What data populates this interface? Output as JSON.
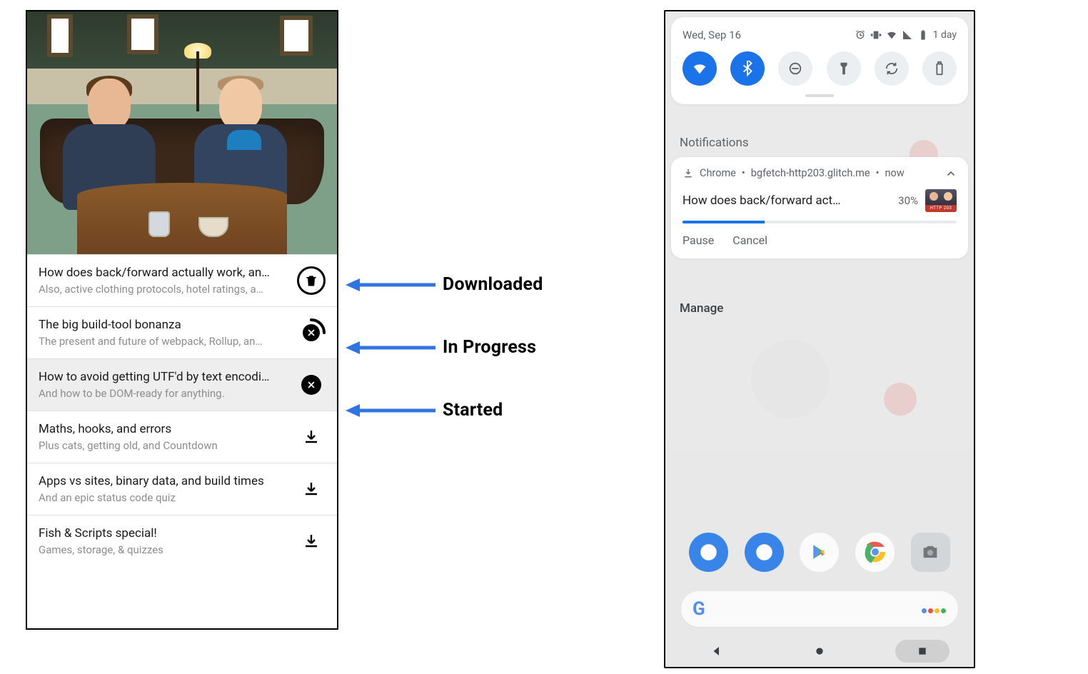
{
  "left": {
    "episodes": [
      {
        "title": "How does back/forward actually work, an…",
        "subtitle": "Also, active clothing protocols, hotel ratings, a…",
        "status": "downloaded"
      },
      {
        "title": "The big build-tool bonanza",
        "subtitle": "The present and future of webpack, Rollup, an…",
        "status": "in_progress"
      },
      {
        "title": "How to avoid getting UTF'd by text encodi…",
        "subtitle": "And how to be DOM-ready for anything.",
        "status": "started"
      },
      {
        "title": "Maths, hooks, and errors",
        "subtitle": "Plus cats, getting old, and Countdown",
        "status": "download"
      },
      {
        "title": "Apps vs sites, binary data, and build times",
        "subtitle": "And an epic status code quiz",
        "status": "download"
      },
      {
        "title": "Fish & Scripts special!",
        "subtitle": "Games, storage, & quizzes",
        "status": "download"
      }
    ]
  },
  "annotations": {
    "downloaded": "Downloaded",
    "in_progress": "In Progress",
    "started": "Started"
  },
  "right": {
    "date": "Wed, Sep 16",
    "battery_text": "1 day",
    "section_label": "Notifications",
    "quick_settings": [
      {
        "name": "wifi",
        "on": true
      },
      {
        "name": "bluetooth",
        "on": true
      },
      {
        "name": "dnd",
        "on": false
      },
      {
        "name": "flashlight",
        "on": false
      },
      {
        "name": "rotate",
        "on": false
      },
      {
        "name": "battery-saver",
        "on": false
      }
    ],
    "notification": {
      "app": "Chrome",
      "source": "bgfetch-http203.glitch.me",
      "time": "now",
      "title": "How does back/forward act…",
      "percent_text": "30%",
      "percent": 30,
      "thumb_tag": "HTTP 203",
      "actions": {
        "pause": "Pause",
        "cancel": "Cancel"
      }
    },
    "manage": "Manage"
  }
}
